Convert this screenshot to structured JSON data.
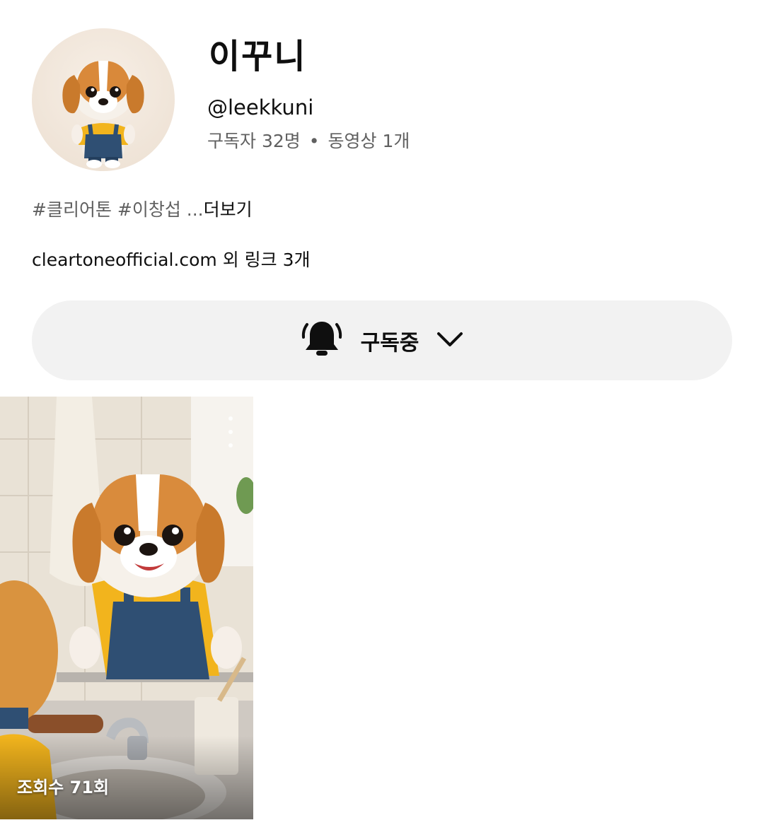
{
  "channel": {
    "name": "이꾸니",
    "handle": "@leekkuni",
    "subscribers": "구독자 32명",
    "separator": "•",
    "videos": "동영상 1개"
  },
  "description": {
    "text": "#클리어톤 #이창섭 ...",
    "more_label": "더보기"
  },
  "links": {
    "text": "cleartoneofficial.com 외 링크 3개"
  },
  "subscribe_button": {
    "label": "구독중",
    "icon": "bell-icon",
    "chevron_icon": "chevron-down-icon"
  },
  "shorts": [
    {
      "views": "조회수 71회",
      "menu_icon": "more-vert-icon"
    }
  ]
}
